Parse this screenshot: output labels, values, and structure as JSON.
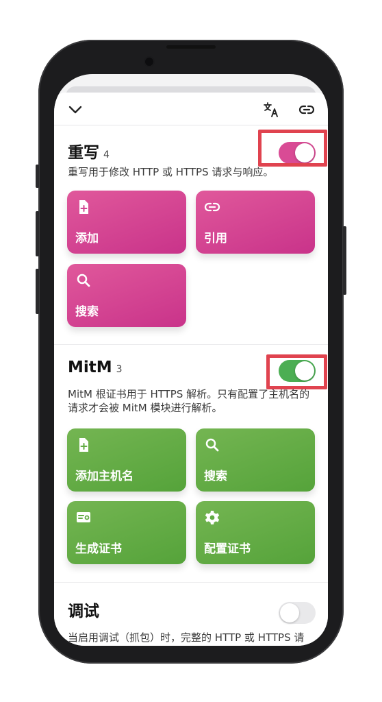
{
  "toolbar": {
    "icons": [
      "chevron-down-icon",
      "translate-icon",
      "link-icon"
    ]
  },
  "rewrite": {
    "title": "重写",
    "count": "4",
    "description": "重写用于修改 HTTP 或 HTTPS 请求与响应。",
    "enabled": true,
    "toggle_color": "#d94b95",
    "tiles": [
      {
        "label": "添加",
        "icon": "file-plus-icon"
      },
      {
        "label": "引用",
        "icon": "link-icon"
      },
      {
        "label": "搜索",
        "icon": "search-icon"
      }
    ]
  },
  "mitm": {
    "title": "MitM",
    "count": "3",
    "description": "MitM 根证书用于 HTTPS 解析。只有配置了主机名的请求才会被 MitM 模块进行解析。",
    "enabled": true,
    "toggle_color": "#4cae53",
    "tiles": [
      {
        "label": "添加主机名",
        "icon": "file-plus-icon"
      },
      {
        "label": "搜索",
        "icon": "search-icon"
      },
      {
        "label": "生成证书",
        "icon": "certificate-icon"
      },
      {
        "label": "配置证书",
        "icon": "gear-icon"
      }
    ]
  },
  "debug": {
    "title": "调试",
    "description": "当启用调试（抓包）时，完整的 HTTP 或 HTTPS 请求与响应将会被记录并存储在本机，且会占用大",
    "enabled": false
  },
  "colors": {
    "highlight": "#e0434f",
    "pink_tile": "#d94b95",
    "green_tile": "#62ab45"
  }
}
